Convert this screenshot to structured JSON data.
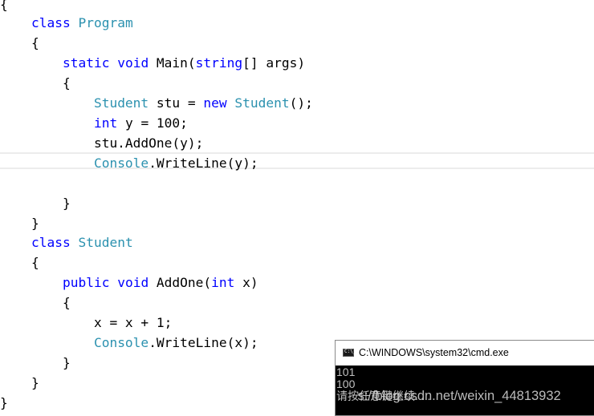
{
  "editor": {
    "language": "C#",
    "highlighted_line_index": 7,
    "lines": [
      {
        "tokens": [
          {
            "t": "{",
            "c": "tx"
          }
        ]
      },
      {
        "tokens": [
          {
            "t": "    ",
            "c": "tx"
          },
          {
            "t": "class",
            "c": "kw"
          },
          {
            "t": " ",
            "c": "tx"
          },
          {
            "t": "Program",
            "c": "ty"
          }
        ]
      },
      {
        "tokens": [
          {
            "t": "    {",
            "c": "tx"
          }
        ]
      },
      {
        "tokens": [
          {
            "t": "        ",
            "c": "tx"
          },
          {
            "t": "static",
            "c": "kw"
          },
          {
            "t": " ",
            "c": "tx"
          },
          {
            "t": "void",
            "c": "kw"
          },
          {
            "t": " Main(",
            "c": "tx"
          },
          {
            "t": "string",
            "c": "kw"
          },
          {
            "t": "[] args)",
            "c": "tx"
          }
        ]
      },
      {
        "tokens": [
          {
            "t": "        {",
            "c": "tx"
          }
        ]
      },
      {
        "tokens": [
          {
            "t": "            ",
            "c": "tx"
          },
          {
            "t": "Student",
            "c": "ty"
          },
          {
            "t": " stu = ",
            "c": "tx"
          },
          {
            "t": "new",
            "c": "kw"
          },
          {
            "t": " ",
            "c": "tx"
          },
          {
            "t": "Student",
            "c": "ty"
          },
          {
            "t": "();",
            "c": "tx"
          }
        ]
      },
      {
        "tokens": [
          {
            "t": "            ",
            "c": "tx"
          },
          {
            "t": "int",
            "c": "kw"
          },
          {
            "t": " y = 100;",
            "c": "tx"
          }
        ]
      },
      {
        "tokens": [
          {
            "t": "            stu.AddOne(y);",
            "c": "tx"
          }
        ]
      },
      {
        "tokens": [
          {
            "t": "            ",
            "c": "tx"
          },
          {
            "t": "Console",
            "c": "ty"
          },
          {
            "t": ".WriteLine(y);",
            "c": "tx"
          }
        ]
      },
      {
        "tokens": [
          {
            "t": "",
            "c": "tx"
          }
        ]
      },
      {
        "tokens": [
          {
            "t": "        }",
            "c": "tx"
          }
        ]
      },
      {
        "tokens": [
          {
            "t": "    }",
            "c": "tx"
          }
        ]
      },
      {
        "tokens": [
          {
            "t": "    ",
            "c": "tx"
          },
          {
            "t": "class",
            "c": "kw"
          },
          {
            "t": " ",
            "c": "tx"
          },
          {
            "t": "Student",
            "c": "ty"
          }
        ]
      },
      {
        "tokens": [
          {
            "t": "    {",
            "c": "tx"
          }
        ]
      },
      {
        "tokens": [
          {
            "t": "        ",
            "c": "tx"
          },
          {
            "t": "public",
            "c": "kw"
          },
          {
            "t": " ",
            "c": "tx"
          },
          {
            "t": "void",
            "c": "kw"
          },
          {
            "t": " AddOne(",
            "c": "tx"
          },
          {
            "t": "int",
            "c": "kw"
          },
          {
            "t": " x)",
            "c": "tx"
          }
        ]
      },
      {
        "tokens": [
          {
            "t": "        {",
            "c": "tx"
          }
        ]
      },
      {
        "tokens": [
          {
            "t": "            x = x + 1;",
            "c": "tx"
          }
        ]
      },
      {
        "tokens": [
          {
            "t": "            ",
            "c": "tx"
          },
          {
            "t": "Console",
            "c": "ty"
          },
          {
            "t": ".WriteLine(x);",
            "c": "tx"
          }
        ]
      },
      {
        "tokens": [
          {
            "t": "        }",
            "c": "tx"
          }
        ]
      },
      {
        "tokens": [
          {
            "t": "    }",
            "c": "tx"
          }
        ]
      },
      {
        "tokens": [
          {
            "t": "}",
            "c": "tx"
          }
        ]
      }
    ],
    "colors": {
      "keyword": "#0000ff",
      "type": "#2b91af",
      "text": "#000000"
    }
  },
  "console": {
    "icon": "cmd-icon",
    "title": "C:\\WINDOWS\\system32\\cmd.exe",
    "output_lines": [
      "101",
      "100",
      "请按任意键继续. . ."
    ]
  },
  "watermark": {
    "text": "https://blog.csdn.net/weixin_44813932"
  }
}
